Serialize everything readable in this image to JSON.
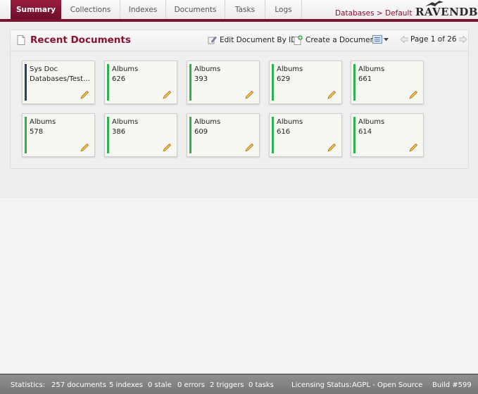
{
  "nav": {
    "tabs": [
      "Summary",
      "Collections",
      "Indexes",
      "Documents",
      "Tasks",
      "Logs"
    ],
    "breadcrumb": {
      "databases": "Databases",
      "separator": ">",
      "current": "Default"
    },
    "logo_text": "RAVENDB"
  },
  "panel": {
    "title": "Recent Documents",
    "edit_by_id": "Edit Document By ID",
    "create_doc": "Create a Document",
    "page_text": "Page 1 of 26"
  },
  "documents": [
    {
      "collection": "Sys Doc",
      "id": "Databases/Test…",
      "type": "system"
    },
    {
      "collection": "Albums",
      "id": "626",
      "type": "albums"
    },
    {
      "collection": "Albums",
      "id": "393",
      "type": "albums"
    },
    {
      "collection": "Albums",
      "id": "629",
      "type": "albums"
    },
    {
      "collection": "Albums",
      "id": "661",
      "type": "albums"
    },
    {
      "collection": "Albums",
      "id": "578",
      "type": "albums"
    },
    {
      "collection": "Albums",
      "id": "386",
      "type": "albums"
    },
    {
      "collection": "Albums",
      "id": "609",
      "type": "albums"
    },
    {
      "collection": "Albums",
      "id": "616",
      "type": "albums"
    },
    {
      "collection": "Albums",
      "id": "614",
      "type": "albums"
    }
  ],
  "status": {
    "label": "Statistics:",
    "documents": "257 documents",
    "indexes": "5 indexes",
    "stale": "0 stale",
    "errors": "0 errors",
    "triggers": "2 triggers",
    "tasks": "0 tasks",
    "license_label": "Licensing Status:",
    "license_value": "AGPL - Open Source",
    "build": "Build #599"
  },
  "colors": {
    "brand": "#8a1230",
    "albums_stripe": "#2fae52",
    "sys_stripe": "#23406e"
  }
}
